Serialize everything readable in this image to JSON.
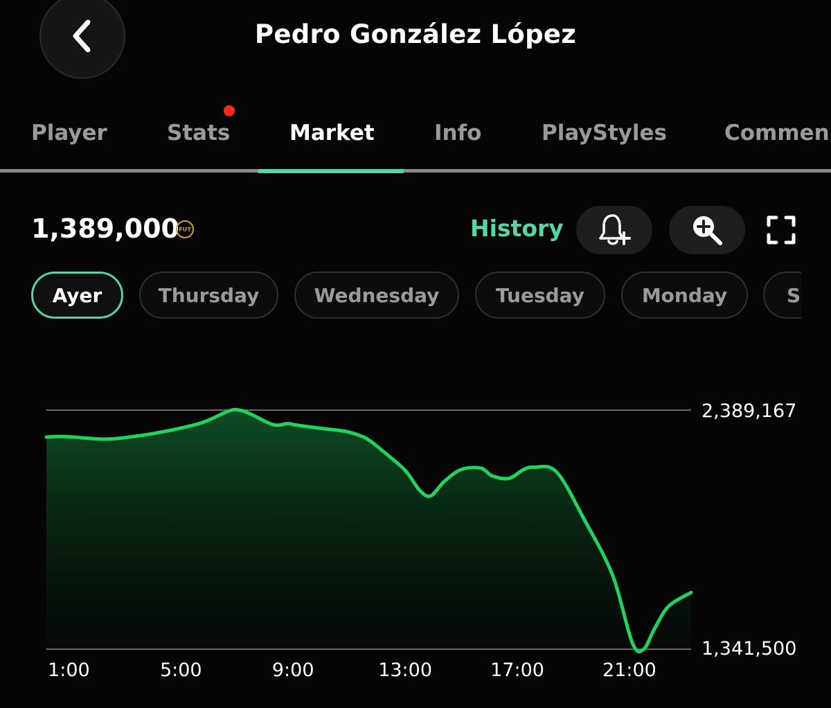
{
  "header": {
    "title": "Pedro González López"
  },
  "tabs": [
    {
      "label": "Player"
    },
    {
      "label": "Stats"
    },
    {
      "label": "Market"
    },
    {
      "label": "Info"
    },
    {
      "label": "PlayStyles"
    },
    {
      "label": "Commen"
    }
  ],
  "active_tab": "Market",
  "market": {
    "price": "1,389,000",
    "coin_label": "FUT",
    "history_label": "History"
  },
  "day_chips": [
    {
      "label": "Ayer"
    },
    {
      "label": "Thursday"
    },
    {
      "label": "Wednesday"
    },
    {
      "label": "Tuesday"
    },
    {
      "label": "Monday"
    },
    {
      "label": "Su"
    }
  ],
  "icons": {
    "back": "chevron-left-icon",
    "alert": "bell-plus-icon",
    "zoom": "zoom-in-icon",
    "fullscreen": "fullscreen-icon",
    "coin": "fut-coin-icon"
  },
  "colors": {
    "accent": "#55d7a3",
    "line": "#22d15e",
    "notification_dot": "#ff2a1a",
    "background": "#050505"
  },
  "chart_data": {
    "type": "area",
    "x_unit": "hour",
    "xlim": [
      0.2,
      23.2
    ],
    "ylim": [
      1341500,
      2389167
    ],
    "y_tick_labels": [
      "2,389,167",
      "1,341,500"
    ],
    "x_ticks": [
      1,
      5,
      9,
      13,
      17,
      21
    ],
    "x_tick_labels": [
      "1:00",
      "5:00",
      "9:00",
      "13:00",
      "17:00",
      "21:00"
    ],
    "x": [
      0.2,
      0.9,
      2.2,
      3.1,
      4.3,
      5.7,
      6.7,
      7.1,
      7.5,
      8.3,
      8.8,
      9.1,
      10.0,
      10.9,
      11.6,
      12.2,
      13.0,
      13.5,
      13.9,
      14.4,
      15.0,
      15.7,
      16.1,
      16.7,
      17.2,
      17.6,
      18.4,
      19.4,
      20.4,
      21.1,
      21.5,
      21.9,
      22.4,
      23.2
    ],
    "y": [
      2271000,
      2273000,
      2262000,
      2270000,
      2293000,
      2332000,
      2385000,
      2389000,
      2371000,
      2325000,
      2330000,
      2324000,
      2309000,
      2295000,
      2266000,
      2210000,
      2125000,
      2040000,
      2013000,
      2077000,
      2129000,
      2135000,
      2101000,
      2090000,
      2127000,
      2139000,
      2118000,
      1907000,
      1665000,
      1370000,
      1340000,
      1432000,
      1530000,
      1590000
    ]
  }
}
